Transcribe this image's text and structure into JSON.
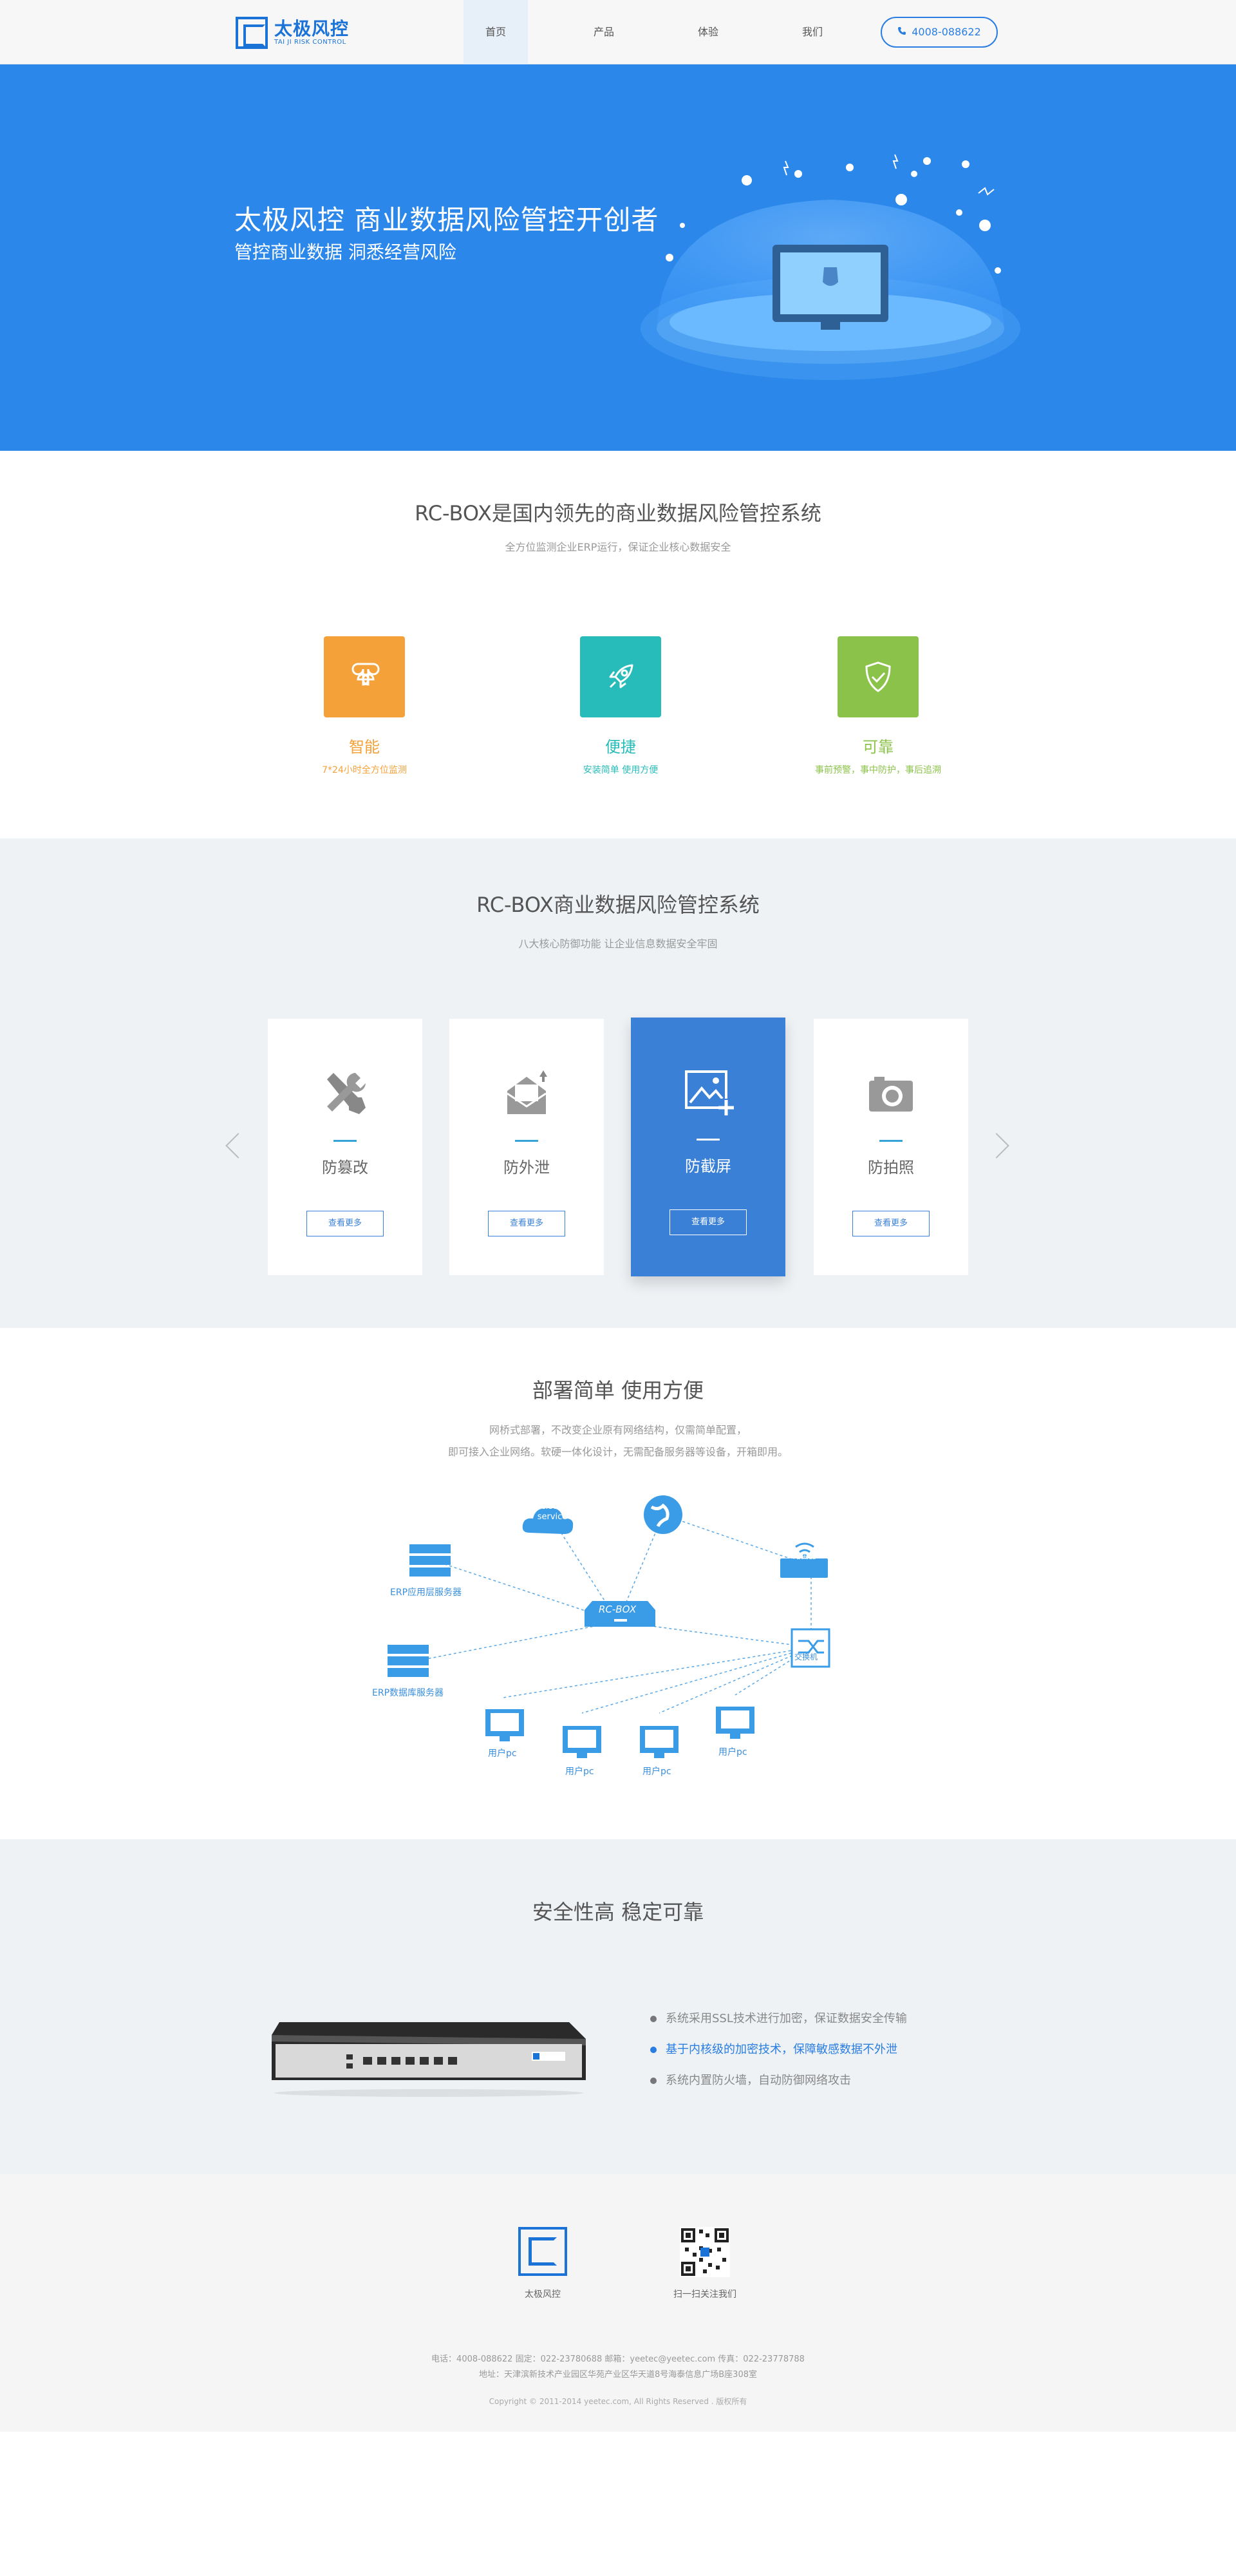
{
  "nav": {
    "logo_cn": "太极风控",
    "logo_en": "TAI JI RISK CONTROL",
    "items": [
      "首页",
      "产品",
      "体验",
      "我们"
    ],
    "phone": "4008-088622"
  },
  "hero": {
    "title": "太极风控  商业数据风险管控开创者",
    "subtitle": "管控商业数据  洞悉经营风险"
  },
  "intro": {
    "title": "RC-BOX是国内领先的商业数据风险管控系统",
    "subtitle": "全方位监测企业ERP运行，保证企业核心数据安全",
    "features": [
      {
        "name": "智能",
        "desc": "7*24小时全方位监测",
        "color": "#f5a13a",
        "icon": "command-icon"
      },
      {
        "name": "便捷",
        "desc": "安装简单 使用方便",
        "color": "#27bcb9",
        "icon": "rocket-icon"
      },
      {
        "name": "可靠",
        "desc": "事前预警，事中防护，事后追溯",
        "color": "#8bc34a",
        "icon": "shield-check-icon"
      }
    ]
  },
  "system": {
    "title": "RC-BOX商业数据风险管控系统",
    "subtitle": "八大核心防御功能 让企业信息数据安全牢固",
    "cards": [
      {
        "name": "防篡改",
        "icon": "tools-icon",
        "button": "查看更多"
      },
      {
        "name": "防外泄",
        "icon": "mail-upload-icon",
        "button": "查看更多"
      },
      {
        "name": "防截屏",
        "icon": "image-add-icon",
        "button": "查看更多"
      },
      {
        "name": "防拍照",
        "icon": "camera-icon",
        "button": "查看更多"
      }
    ]
  },
  "deploy": {
    "title": "部署简单  使用方便",
    "lines": [
      "网桥式部署，不改变企业原有网络结构，仅需简单配置，",
      "即可接入企业网络。软硬一体化设计，无需配备服务器等设备，开箱即用。"
    ],
    "nodes": {
      "cloud": "cloud service",
      "rcbox": "RC-BOX",
      "router": "路由器",
      "switch": "交换机",
      "erp_app": "ERP应用层服务器",
      "erp_db": "ERP数据库服务器",
      "pcs": [
        "用户pc",
        "用户pc",
        "用户pc",
        "用户pc"
      ]
    }
  },
  "security": {
    "title": "安全性高  稳定可靠",
    "bullets": [
      "系统采用SSL技术进行加密，保证数据安全传输",
      "基于内核级的加密技术，保障敏感数据不外泄",
      "系统内置防火墙，自动防御网络攻击"
    ]
  },
  "footer": {
    "logo_caption": "太极风控",
    "qr_caption": "扫一扫关注我们",
    "contact": "电话：4008-088622    固定：022-23780688    邮箱：yeetec@yeetec.com    传真：022-23778788",
    "address": "地址：天津滨新技术产业园区华苑产业区华天道8号海泰信息广场B座308室",
    "copyright": "Copyright © 2011-2014 yeetec.com, All Rights Reserved . 版权所有"
  },
  "colors": {
    "primary": "#2b87ea",
    "accent": "#3a80d6"
  }
}
